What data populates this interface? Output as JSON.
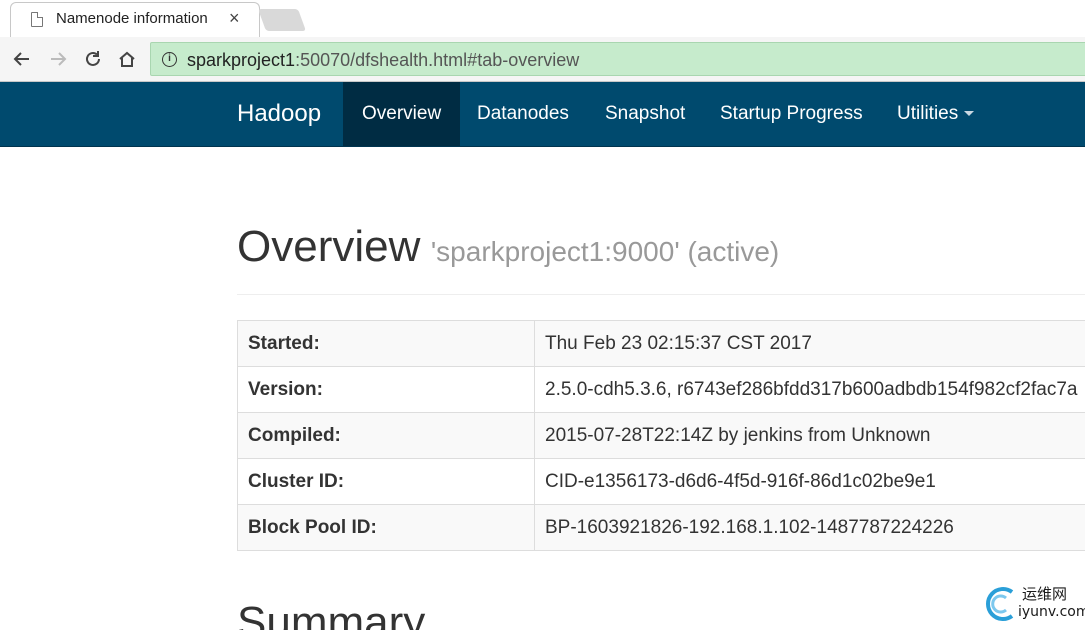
{
  "browser": {
    "tab_title": "Namenode information",
    "tab_close": "×",
    "url_host": "sparkproject1",
    "url_rest": ":50070/dfshealth.html#tab-overview"
  },
  "navbar": {
    "brand": "Hadoop",
    "items": [
      {
        "label": "Overview",
        "active": true
      },
      {
        "label": "Datanodes"
      },
      {
        "label": "Snapshot"
      },
      {
        "label": "Startup Progress"
      },
      {
        "label": "Utilities",
        "dropdown": true
      }
    ],
    "colors": {
      "background": "#004a6e",
      "active": "#002c43"
    }
  },
  "header": {
    "title": "Overview",
    "subtitle": "'sparkproject1:9000' (active)"
  },
  "overview_table": [
    {
      "key": "Started:",
      "value": "Thu Feb 23 02:15:37 CST 2017"
    },
    {
      "key": "Version:",
      "value": "2.5.0-cdh5.3.6, r6743ef286bfdd317b600adbdb154f982cf2fac7a"
    },
    {
      "key": "Compiled:",
      "value": "2015-07-28T22:14Z by jenkins from Unknown"
    },
    {
      "key": "Cluster ID:",
      "value": "CID-e1356173-d6d6-4f5d-916f-86d1c02be9e1"
    },
    {
      "key": "Block Pool ID:",
      "value": "BP-1603921826-192.168.1.102-1487787224226"
    }
  ],
  "summary_heading": "Summary",
  "watermark": {
    "cn": "运维网",
    "en": "iyunv.com"
  }
}
